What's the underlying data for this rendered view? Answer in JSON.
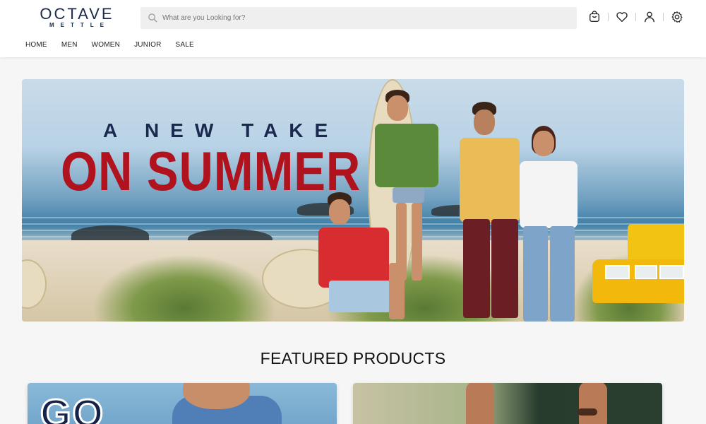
{
  "brand": {
    "name": "OCTAVE",
    "sub": "METTLE",
    "color": "#1c2a4a"
  },
  "search": {
    "placeholder": "What are you Looking for?",
    "icon": "search-icon"
  },
  "header_icons": [
    "cart-icon",
    "heart-icon",
    "user-icon",
    "settings-icon"
  ],
  "nav": {
    "items": [
      {
        "label": "HOME"
      },
      {
        "label": "MEN"
      },
      {
        "label": "WOMEN"
      },
      {
        "label": "JUNIOR"
      },
      {
        "label": "SALE"
      }
    ]
  },
  "banner": {
    "line1": "A NEW TAKE",
    "line2": "ON SUMMER",
    "line1_color": "#1a2a4e",
    "line2_color": "#b0121e"
  },
  "featured": {
    "title": "FEATURED PRODUCTS",
    "cards": [
      {
        "overlay_text": "GO"
      },
      {
        "overlay_text": ""
      }
    ]
  }
}
